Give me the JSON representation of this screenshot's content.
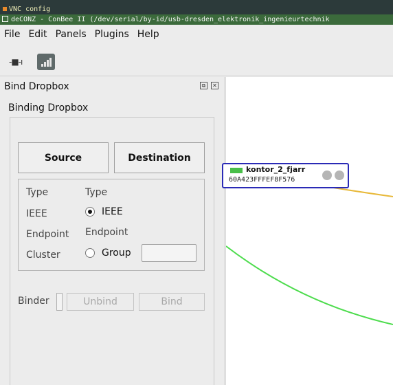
{
  "vnc": {
    "title": "VNC config"
  },
  "window": {
    "title": "deCONZ - ConBee II (/dev/serial/by-id/usb-dresden_elektronik_ingenieurtechnik"
  },
  "menubar": {
    "items": [
      "File",
      "Edit",
      "Panels",
      "Plugins",
      "Help"
    ]
  },
  "toolbar": {
    "connect_icon": "plug-icon",
    "network_icon": "signal-bars-icon"
  },
  "panel": {
    "title": "Bind Dropbox",
    "group_title": "Binding Dropbox",
    "source_label": "Source",
    "destination_label": "Destination",
    "source": {
      "type": "Type",
      "ieee": "IEEE",
      "endpoint": "Endpoint",
      "cluster": "Cluster"
    },
    "destination": {
      "type": "Type",
      "ieee": "IEEE",
      "endpoint": "Endpoint",
      "group": "Group",
      "group_value": ""
    },
    "binder_label": "Binder",
    "unbind_label": "Unbind",
    "bind_label": "Bind"
  },
  "node": {
    "name": "kontor_2_fjarr",
    "address": "60A423FFFEF8F576"
  },
  "colors": {
    "node_border": "#2a2ab6",
    "link_green": "#4ddc4d",
    "link_yellow": "#e8b93a",
    "window_title_bg": "#3b6a3b"
  }
}
